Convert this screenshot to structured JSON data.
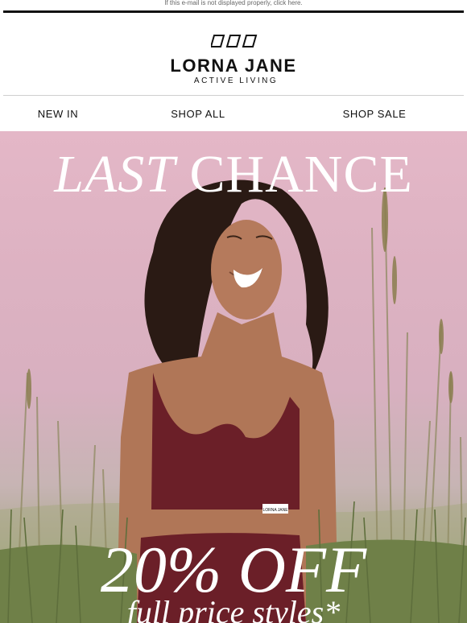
{
  "preheader": {
    "text": "If this e-mail is not displayed properly, click here."
  },
  "brand": {
    "name": "LORNA JANE",
    "tagline": "ACTIVE LIVING"
  },
  "nav": {
    "items": [
      {
        "label": "NEW IN"
      },
      {
        "label": "SHOP ALL"
      },
      {
        "label": "SHOP SALE"
      }
    ]
  },
  "hero": {
    "title_italic": "LAST",
    "title_regular": "CHANCE",
    "offer": "20% OFF",
    "offer_sub": "full price styles*",
    "garment_label": "LORNA JANE"
  },
  "colors": {
    "accent": "#111111",
    "sky": "#e4b7c7",
    "grass": "#7e8c58",
    "garment": "#6b1f28"
  }
}
